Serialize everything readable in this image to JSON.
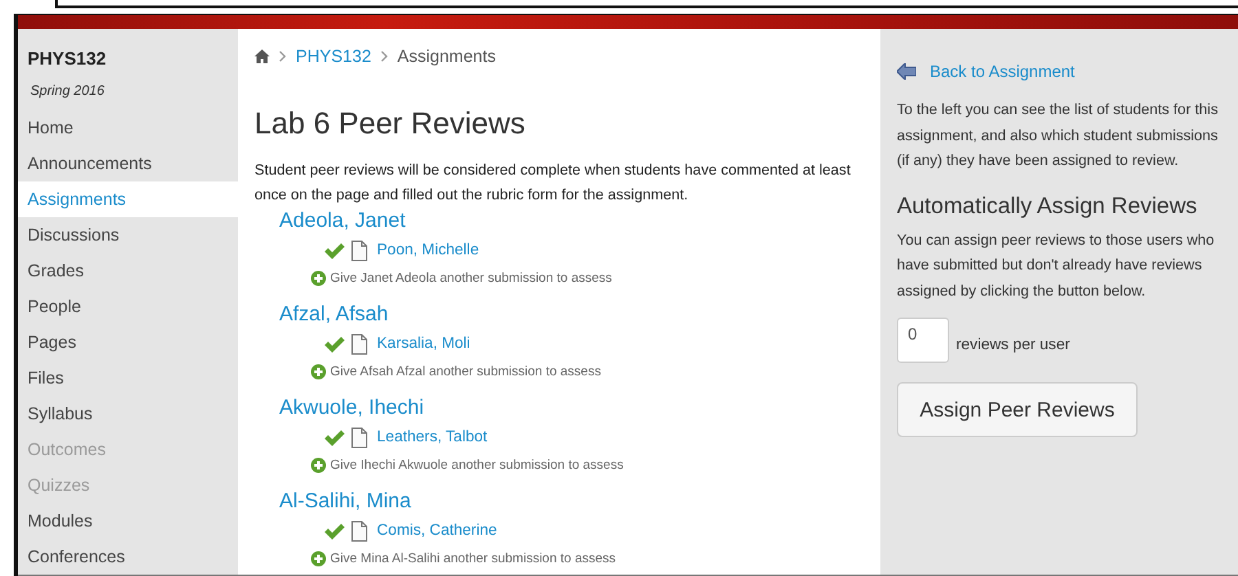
{
  "course": {
    "code": "PHYS132",
    "term": "Spring 2016"
  },
  "nav": [
    {
      "label": "Home",
      "selected": false,
      "disabled": false
    },
    {
      "label": "Announcements",
      "selected": false,
      "disabled": false
    },
    {
      "label": "Assignments",
      "selected": true,
      "disabled": false
    },
    {
      "label": "Discussions",
      "selected": false,
      "disabled": false
    },
    {
      "label": "Grades",
      "selected": false,
      "disabled": false
    },
    {
      "label": "People",
      "selected": false,
      "disabled": false
    },
    {
      "label": "Pages",
      "selected": false,
      "disabled": false
    },
    {
      "label": "Files",
      "selected": false,
      "disabled": false
    },
    {
      "label": "Syllabus",
      "selected": false,
      "disabled": false
    },
    {
      "label": "Outcomes",
      "selected": false,
      "disabled": true
    },
    {
      "label": "Quizzes",
      "selected": false,
      "disabled": true
    },
    {
      "label": "Modules",
      "selected": false,
      "disabled": false
    },
    {
      "label": "Conferences",
      "selected": false,
      "disabled": false
    }
  ],
  "breadcrumb": [
    {
      "label": "PHYS132",
      "link": true
    },
    {
      "label": "Assignments",
      "link": false
    }
  ],
  "title": "Lab 6 Peer Reviews",
  "intro": "Student peer reviews will be considered complete when students have commented at least once on the page and filled out the rubric form for the assignment.",
  "students": [
    {
      "name": "Adeola, Janet",
      "reviews": [
        {
          "name": "Poon, Michelle",
          "complete": true
        }
      ],
      "add": "Give Janet Adeola another submission to assess"
    },
    {
      "name": "Afzal, Afsah",
      "reviews": [
        {
          "name": "Karsalia, Moli",
          "complete": true
        }
      ],
      "add": "Give Afsah Afzal another submission to assess"
    },
    {
      "name": "Akwuole, Ihechi",
      "reviews": [
        {
          "name": "Leathers, Talbot",
          "complete": true
        }
      ],
      "add": "Give Ihechi Akwuole another submission to assess"
    },
    {
      "name": "Al-Salihi, Mina",
      "reviews": [
        {
          "name": "Comis, Catherine",
          "complete": true
        }
      ],
      "add": "Give Mina Al-Salihi another submission to assess"
    }
  ],
  "aside": {
    "back": "Back to Assignment",
    "info": "To the left you can see the list of students for this assignment, and also which student submissions (if any) they have been assigned to review.",
    "heading": "Automatically Assign Reviews",
    "auto_info": "You can assign peer reviews to those users who have submitted but don't already have reviews assigned by clicking the button below.",
    "count": "0",
    "count_label": "reviews per user",
    "button": "Assign Peer Reviews"
  }
}
